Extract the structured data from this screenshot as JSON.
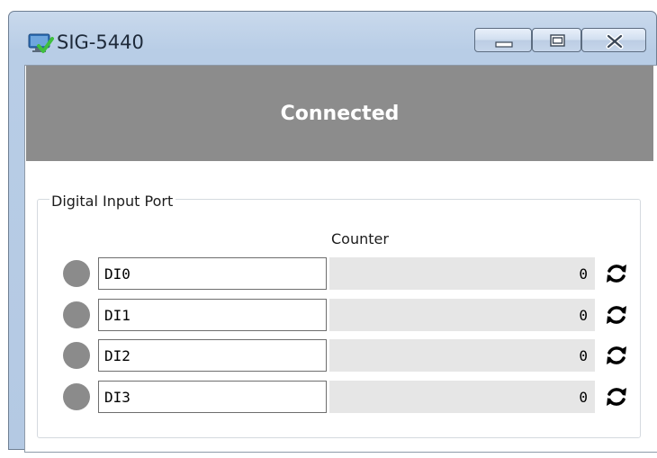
{
  "window": {
    "title": "SIG-5440",
    "app_icon": "monitor-check-icon",
    "controls": [
      "minimize-icon",
      "maximize-icon",
      "close-icon"
    ]
  },
  "status": {
    "text": "Connected",
    "background_color": "#8c8c8c"
  },
  "digital_input": {
    "group_title": "Digital Input Port",
    "counter_header": "Counter",
    "reset_icon": "reset-counter-icon",
    "led_color_off": "#8b8b8b",
    "ports": [
      {
        "name": "DI0",
        "counter": "0",
        "state": "off"
      },
      {
        "name": "DI1",
        "counter": "0",
        "state": "off"
      },
      {
        "name": "DI2",
        "counter": "0",
        "state": "off"
      },
      {
        "name": "DI3",
        "counter": "0",
        "state": "off"
      }
    ]
  }
}
